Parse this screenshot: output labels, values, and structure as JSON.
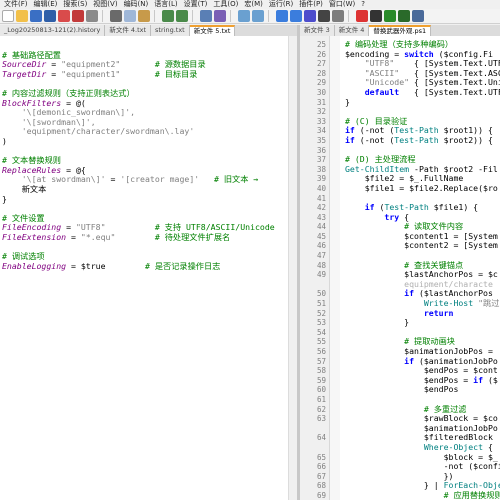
{
  "menu": [
    "文件(F)",
    "编辑(E)",
    "搜索(S)",
    "视图(V)",
    "编码(N)",
    "语言(L)",
    "设置(T)",
    "工具(O)",
    "宏(M)",
    "运行(R)",
    "插件(P)",
    "窗口(W)",
    "?"
  ],
  "tabs_left": [
    "_Log20250813-121(2).history",
    "新文件 4.txt",
    "string.txt",
    "新文件 5.txt"
  ],
  "tabs_right": [
    "新文件 3",
    "新文件 4",
    "替换武器外观.ps1"
  ],
  "left_lines": [
    [],
    [
      {
        "t": "# 基础路径配置",
        "c": "cmt"
      }
    ],
    [
      {
        "t": "SourceDir",
        "c": "var"
      },
      {
        "t": " = ",
        "c": "plain"
      },
      {
        "t": "\"equipment2\"",
        "c": "str"
      },
      {
        "t": "       # 源数据目录",
        "c": "cmt"
      }
    ],
    [
      {
        "t": "TargetDir",
        "c": "var"
      },
      {
        "t": " = ",
        "c": "plain"
      },
      {
        "t": "\"equipment1\"",
        "c": "str"
      },
      {
        "t": "       # 目标目录",
        "c": "cmt"
      }
    ],
    [],
    [
      {
        "t": "# 内容过滤规则（支持正则表达式）",
        "c": "cmt"
      }
    ],
    [
      {
        "t": "BlockFilters",
        "c": "var"
      },
      {
        "t": " = @(",
        "c": "plain"
      }
    ],
    [
      {
        "t": "    '\\[demonic_swordman\\]',",
        "c": "str"
      }
    ],
    [
      {
        "t": "    '\\[swordman\\]',",
        "c": "str"
      }
    ],
    [
      {
        "t": "    'equipment/character/swordman\\.lay'",
        "c": "str"
      }
    ],
    [
      {
        "t": ")",
        "c": "plain"
      }
    ],
    [],
    [
      {
        "t": "# 文本替换规则",
        "c": "cmt"
      }
    ],
    [
      {
        "t": "ReplaceRules",
        "c": "var"
      },
      {
        "t": " = @{",
        "c": "plain"
      }
    ],
    [
      {
        "t": "    '\\[at swordman\\]'",
        "c": "str"
      },
      {
        "t": " = ",
        "c": "plain"
      },
      {
        "t": "'[creator mage]'",
        "c": "str"
      },
      {
        "t": "   # 旧文本 →",
        "c": "cmt"
      }
    ],
    [
      {
        "t": "    新文本",
        "c": "plain"
      }
    ],
    [
      {
        "t": "}",
        "c": "plain"
      }
    ],
    [],
    [
      {
        "t": "# 文件设置",
        "c": "cmt"
      }
    ],
    [
      {
        "t": "FileEncoding",
        "c": "var"
      },
      {
        "t": " = ",
        "c": "plain"
      },
      {
        "t": "\"UTF8\"",
        "c": "str"
      },
      {
        "t": "          # 支持 UTF8/ASCII/Unicode",
        "c": "cmt"
      }
    ],
    [
      {
        "t": "FileExtension",
        "c": "var"
      },
      {
        "t": " = ",
        "c": "plain"
      },
      {
        "t": "\"*.equ\"",
        "c": "str"
      },
      {
        "t": "        # 待处理文件扩展名",
        "c": "cmt"
      }
    ],
    [],
    [
      {
        "t": "# 调试选项",
        "c": "cmt"
      }
    ],
    [
      {
        "t": "EnableLogging",
        "c": "var"
      },
      {
        "t": " = $true",
        "c": "plain"
      },
      {
        "t": "        # 是否记录操作日志",
        "c": "cmt"
      }
    ]
  ],
  "right_lines": [
    {
      "n": "25",
      "s": [
        {
          "t": "# 编码处理（支持多种编码）",
          "c": "cmt"
        }
      ]
    },
    {
      "n": "26",
      "s": [
        {
          "t": "$encoding = ",
          "c": "plain"
        },
        {
          "t": "switch",
          "c": "kw"
        },
        {
          "t": " ($config.Fi",
          "c": "plain"
        }
      ]
    },
    {
      "n": "27",
      "s": [
        {
          "t": "    \"UTF8\"",
          "c": "str"
        },
        {
          "t": "    { [System.Text.UTF",
          "c": "plain"
        }
      ]
    },
    {
      "n": "28",
      "s": [
        {
          "t": "    \"ASCII\"",
          "c": "str"
        },
        {
          "t": "   { [System.Text.ASC",
          "c": "plain"
        }
      ]
    },
    {
      "n": "29",
      "s": [
        {
          "t": "    \"Unicode\"",
          "c": "str"
        },
        {
          "t": " { [System.Text.Uni",
          "c": "plain"
        }
      ]
    },
    {
      "n": "30",
      "s": [
        {
          "t": "    default",
          "c": "kw"
        },
        {
          "t": "   { [System.Text.UTF",
          "c": "plain"
        }
      ]
    },
    {
      "n": "31",
      "s": [
        {
          "t": "}",
          "c": "plain"
        }
      ]
    },
    {
      "n": "32",
      "s": []
    },
    {
      "n": "33",
      "s": [
        {
          "t": "# (C) 目录验证",
          "c": "cmt"
        }
      ]
    },
    {
      "n": "34",
      "s": [
        {
          "t": "if",
          "c": "kw"
        },
        {
          "t": " (-not (",
          "c": "plain"
        },
        {
          "t": "Test-Path",
          "c": "typ"
        },
        {
          "t": " $root1)) {",
          "c": "plain"
        }
      ]
    },
    {
      "n": "35",
      "s": [
        {
          "t": "if",
          "c": "kw"
        },
        {
          "t": " (-not (",
          "c": "plain"
        },
        {
          "t": "Test-Path",
          "c": "typ"
        },
        {
          "t": " $root2)) {",
          "c": "plain"
        }
      ]
    },
    {
      "n": "36",
      "s": []
    },
    {
      "n": "37",
      "s": [
        {
          "t": "# (D) 主处理流程",
          "c": "cmt"
        }
      ]
    },
    {
      "n": "38",
      "s": [
        {
          "t": "Get-ChildItem",
          "c": "typ"
        },
        {
          "t": " -Path $root2 -Fil",
          "c": "plain"
        }
      ]
    },
    {
      "n": "39",
      "s": [
        {
          "t": "    $file2 = $_.FullName",
          "c": "plain"
        }
      ]
    },
    {
      "n": "40",
      "s": [
        {
          "t": "    $file1 = $file2.Replace($ro",
          "c": "plain"
        }
      ]
    },
    {
      "n": "41",
      "s": []
    },
    {
      "n": "42",
      "s": [
        {
          "t": "    if",
          "c": "kw"
        },
        {
          "t": " (",
          "c": "plain"
        },
        {
          "t": "Test-Path",
          "c": "typ"
        },
        {
          "t": " $file1) {",
          "c": "plain"
        }
      ]
    },
    {
      "n": "43",
      "s": [
        {
          "t": "        try",
          "c": "kw"
        },
        {
          "t": " {",
          "c": "plain"
        }
      ]
    },
    {
      "n": "44",
      "s": [
        {
          "t": "            # 读取文件内容",
          "c": "cmt"
        }
      ]
    },
    {
      "n": "45",
      "s": [
        {
          "t": "            $content1 = [System",
          "c": "plain"
        }
      ]
    },
    {
      "n": "46",
      "s": [
        {
          "t": "            $content2 = [System",
          "c": "plain"
        }
      ]
    },
    {
      "n": "47",
      "s": []
    },
    {
      "n": "48",
      "s": [
        {
          "t": "            # 查找关键锚点",
          "c": "cmt"
        }
      ]
    },
    {
      "n": "49",
      "s": [
        {
          "t": "            $lastAnchorPos = $c",
          "c": "plain"
        }
      ]
    },
    {
      "n": "",
      "s": [
        {
          "t": "            equipment/characte",
          "c": "dim"
        }
      ]
    },
    {
      "n": "50",
      "s": [
        {
          "t": "            if",
          "c": "kw"
        },
        {
          "t": " ($lastAnchorPos",
          "c": "plain"
        }
      ]
    },
    {
      "n": "51",
      "s": [
        {
          "t": "                Write-Host",
          "c": "typ"
        },
        {
          "t": " \"跳过",
          "c": "str"
        }
      ]
    },
    {
      "n": "52",
      "s": [
        {
          "t": "                return",
          "c": "kw"
        }
      ]
    },
    {
      "n": "53",
      "s": [
        {
          "t": "            }",
          "c": "plain"
        }
      ]
    },
    {
      "n": "54",
      "s": []
    },
    {
      "n": "55",
      "s": [
        {
          "t": "            # 提取动画块",
          "c": "cmt"
        }
      ]
    },
    {
      "n": "56",
      "s": [
        {
          "t": "            $animationJobPos = ",
          "c": "plain"
        }
      ]
    },
    {
      "n": "57",
      "s": [
        {
          "t": "            if",
          "c": "kw"
        },
        {
          "t": " ($animationJobPo",
          "c": "plain"
        }
      ]
    },
    {
      "n": "58",
      "s": [
        {
          "t": "                $endPos = $cont",
          "c": "plain"
        }
      ]
    },
    {
      "n": "59",
      "s": [
        {
          "t": "                $endPos = ",
          "c": "plain"
        },
        {
          "t": "if",
          "c": "kw"
        },
        {
          "t": " ($",
          "c": "plain"
        }
      ]
    },
    {
      "n": "60",
      "s": [
        {
          "t": "                $endPos",
          "c": "plain"
        }
      ]
    },
    {
      "n": "61",
      "s": []
    },
    {
      "n": "62",
      "s": [
        {
          "t": "                # 多重过滤",
          "c": "cmt"
        }
      ]
    },
    {
      "n": "63",
      "s": [
        {
          "t": "                $rawBlock = $co",
          "c": "plain"
        }
      ]
    },
    {
      "n": "",
      "s": [
        {
          "t": "                $animationJobPo",
          "c": "plain"
        }
      ]
    },
    {
      "n": "64",
      "s": [
        {
          "t": "                $filteredBlock",
          "c": "plain"
        }
      ]
    },
    {
      "n": "",
      "s": [
        {
          "t": "                Where-Object",
          "c": "typ"
        },
        {
          "t": " {",
          "c": "plain"
        }
      ]
    },
    {
      "n": "65",
      "s": [
        {
          "t": "                    $block = $_",
          "c": "plain"
        }
      ]
    },
    {
      "n": "66",
      "s": [
        {
          "t": "                    -not ($config",
          "c": "plain"
        }
      ]
    },
    {
      "n": "67",
      "s": [
        {
          "t": "                    })",
          "c": "plain"
        }
      ]
    },
    {
      "n": "68",
      "s": [
        {
          "t": "                } | ",
          "c": "plain"
        },
        {
          "t": "ForEach-Obje",
          "c": "typ"
        }
      ]
    },
    {
      "n": "69",
      "s": [
        {
          "t": "                    # 应用替换规则",
          "c": "cmt"
        }
      ]
    },
    {
      "n": "70",
      "s": [
        {
          "t": "                    $current = $",
          "c": "plain"
        }
      ]
    }
  ]
}
